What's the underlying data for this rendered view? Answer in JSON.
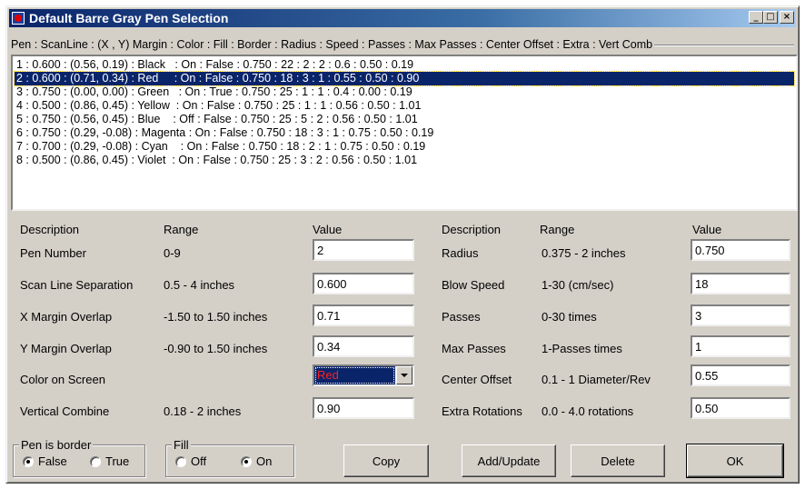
{
  "window": {
    "title": "Default Barre Gray Pen Selection"
  },
  "titlebar_buttons": {
    "minimize": "_",
    "maximize": "□",
    "close": "×"
  },
  "list": {
    "header": "Pen : ScanLine : (X , Y) Margin : Color : Fill : Border : Radius : Speed : Passes : Max Passes : Center Offset : Extra : Vert Comb",
    "selected_index": 1,
    "items": [
      "1 : 0.600 : (0.56, 0.19) : Black   : On : False : 0.750 : 22 : 2 : 2 : 0.6 : 0.50 : 0.19",
      "2 : 0.600 : (0.71, 0.34) : Red     : On : False : 0.750 : 18 : 3 : 1 : 0.55 : 0.50 : 0.90",
      "3 : 0.750 : (0.00, 0.00) : Green   : On : True : 0.750 : 25 : 1 : 1 : 0.4 : 0.00 : 0.19",
      "4 : 0.500 : (0.86, 0.45) : Yellow  : On : False : 0.750 : 25 : 1 : 1 : 0.56 : 0.50 : 1.01",
      "5 : 0.750 : (0.56, 0.45) : Blue    : Off : False : 0.750 : 25 : 5 : 2 : 0.56 : 0.50 : 1.01",
      "6 : 0.750 : (0.29, -0.08) : Magenta : On : False : 0.750 : 18 : 3 : 1 : 0.75 : 0.50 : 0.19",
      "7 : 0.700 : (0.29, -0.08) : Cyan    : On : False : 0.750 : 18 : 2 : 1 : 0.75 : 0.50 : 0.19",
      "8 : 0.500 : (0.86, 0.45) : Violet  : On : False : 0.750 : 25 : 3 : 2 : 0.56 : 0.50 : 1.01"
    ]
  },
  "left": {
    "headers": {
      "description": "Description",
      "range": "Range",
      "value": "Value"
    },
    "pen_number": {
      "label": "Pen Number",
      "range": "0-9",
      "value": "2"
    },
    "scan_line": {
      "label": "Scan Line Separation",
      "range": "0.5 - 4 inches",
      "value": "0.600"
    },
    "x_margin": {
      "label": "X Margin Overlap",
      "range": "-1.50 to 1.50 inches",
      "value": "0.71"
    },
    "y_margin": {
      "label": "Y Margin Overlap",
      "range": "-0.90 to 1.50 inches",
      "value": "0.34"
    },
    "color": {
      "label": "Color on Screen",
      "value": "Red"
    },
    "vertical_combine": {
      "label": "Vertical Combine",
      "range": "0.18 - 2 inches",
      "value": "0.90"
    }
  },
  "right": {
    "headers": {
      "description": "Description",
      "range": "Range",
      "value": "Value"
    },
    "radius": {
      "label": "Radius",
      "range": "0.375 - 2 inches",
      "value": "0.750"
    },
    "blow_speed": {
      "label": "Blow Speed",
      "range": "1-30 (cm/sec)",
      "value": "18"
    },
    "passes": {
      "label": "Passes",
      "range": "0-30 times",
      "value": "3"
    },
    "max_passes": {
      "label": "Max Passes",
      "range": "1-Passes times",
      "value": "1"
    },
    "center_offset": {
      "label": "Center Offset",
      "range": "0.1 - 1 Diameter/Rev",
      "value": "0.55"
    },
    "extra_rotations": {
      "label": "Extra Rotations",
      "range": "0.0 - 4.0 rotations",
      "value": "0.50"
    }
  },
  "pen_border": {
    "label": "Pen is border",
    "option_false": "False",
    "option_true": "True",
    "selected": "False"
  },
  "fill": {
    "label": "Fill",
    "option_off": "Off",
    "option_on": "On",
    "selected": "On"
  },
  "buttons": {
    "copy": "Copy",
    "add_update": "Add/Update",
    "delete": "Delete",
    "ok": "OK"
  },
  "colors": {
    "title_active": "#0a246a",
    "selection": "#0a246a",
    "face": "#d4d0c8",
    "color_text": "#ff2020"
  }
}
